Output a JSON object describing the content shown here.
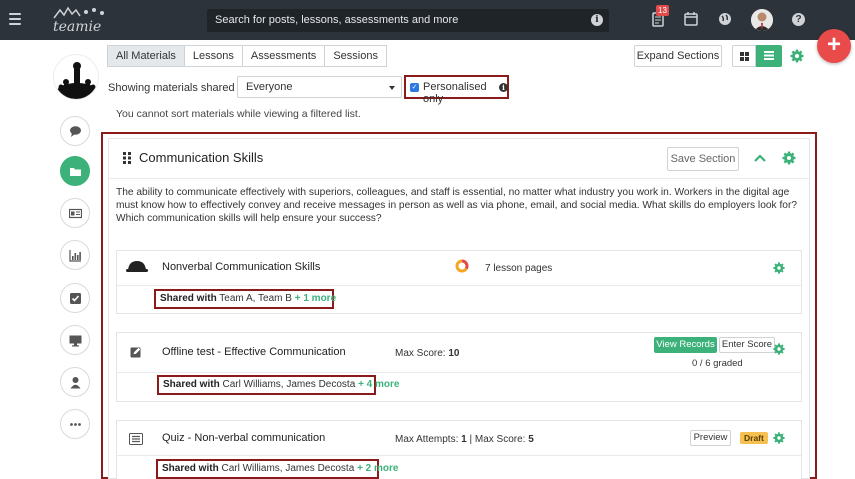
{
  "topbar": {
    "search_placeholder": "Search for posts, lessons, assessments and more",
    "notification_count": "13"
  },
  "tabs": [
    {
      "label": "All Materials",
      "active": true
    },
    {
      "label": "Lessons",
      "active": false
    },
    {
      "label": "Assessments",
      "active": false
    },
    {
      "label": "Sessions",
      "active": false
    }
  ],
  "toolbar": {
    "expand_label": "Expand Sections"
  },
  "filter": {
    "label": "Showing materials shared with",
    "selected": "Everyone",
    "personalised_label": "Personalised only",
    "personalised_checked": true,
    "notice": "You cannot sort materials while viewing a filtered list."
  },
  "sidenav": [
    "posts-icon",
    "materials-icon",
    "gradebook-icon",
    "analytics-icon",
    "tasks-icon",
    "screen-icon",
    "members-icon",
    "more-icon"
  ],
  "section": {
    "title": "Communication Skills",
    "save_label": "Save Section",
    "description": "The ability to communicate effectively with superiors, colleagues, and staff is essential, no matter what industry you work in. Workers in the digital age must know how to effectively convey and receive messages in person as well as via phone, email, and social media. What skills do employers look for? Which communication skills will help ensure your success?"
  },
  "materials": [
    {
      "title": "Nonverbal Communication Skills",
      "meta": "7 lesson pages",
      "shared_label": "Shared with",
      "shared_with": "Team A, Team B",
      "more": "+ 1 more"
    },
    {
      "title": "Offline test - Effective Communication",
      "meta_label": "Max Score:",
      "meta_value": "10",
      "view_records": "View Records",
      "enter_score": "Enter Score",
      "graded": "0 / 6 graded",
      "shared_label": "Shared with",
      "shared_with": "Carl Williams, James Decosta",
      "more": "+ 4 more"
    },
    {
      "title": "Quiz - Non-verbal communication",
      "attempts_label": "Max Attempts:",
      "attempts_value": "1",
      "score_label": "| Max Score:",
      "score_value": "5",
      "preview": "Preview",
      "badge": "Draft",
      "shared_label": "Shared with",
      "shared_with": "Carl Williams, James Decosta",
      "more": "+ 2 more"
    }
  ],
  "colors": {
    "topbar": "#2d333a",
    "accent_green": "#3db17a",
    "fab_red": "#e94b4b",
    "highlight_outline": "#8b1a1a"
  }
}
